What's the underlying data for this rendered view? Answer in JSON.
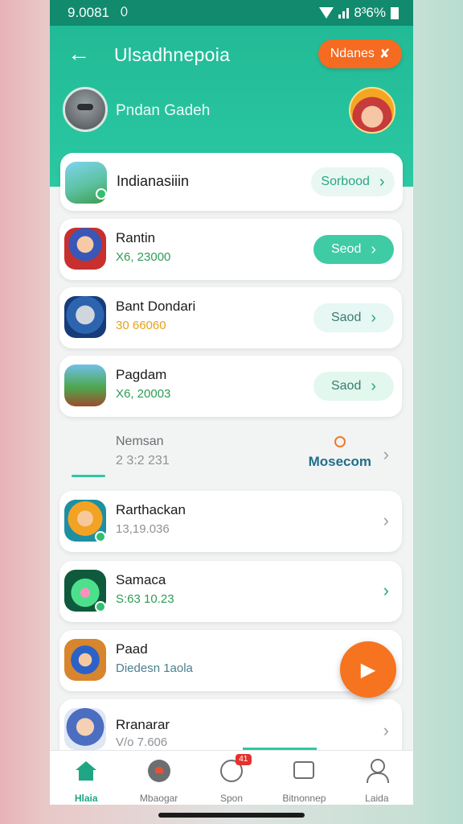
{
  "status": {
    "time": "9.0081",
    "cam_glyph": "⬯",
    "battery_text": "8³6%"
  },
  "header": {
    "back_glyph": "←",
    "title": "Ulsadhnepoia",
    "action_label": "Ndanes",
    "action_glyph": "✘",
    "user_name": "Pndan Gadeh"
  },
  "featured": {
    "name": "Indianasiiin",
    "button_label": "Sorbood"
  },
  "apps": [
    {
      "name": "Rantin",
      "sub": "X6, 23000",
      "button_label": "Seod"
    },
    {
      "name": "Bant Dondari",
      "sub": "30 66060",
      "button_label": "Saod"
    },
    {
      "name": "Pagdam",
      "sub": "X6, 20003",
      "button_label": "Saod"
    }
  ],
  "plain_row": {
    "name": "Nemsan",
    "sub": "2 3:2 231",
    "link_label": "Mosecom"
  },
  "list": [
    {
      "name": "Rarthackan",
      "sub": "13,19.036"
    },
    {
      "name": "Samaca",
      "sub": "S:63 10.23"
    },
    {
      "name": "Paad",
      "sub": "Diedesn  1aola"
    },
    {
      "name": "Rranarar",
      "sub": "V/o 7.606"
    }
  ],
  "fab_glyph": "▶",
  "chevron_glyph": "›",
  "nav": {
    "items": [
      {
        "label": "Hlaia"
      },
      {
        "label": "Mbaogar"
      },
      {
        "label": "Spon",
        "badge": "41"
      },
      {
        "label": "Bitnonnep"
      },
      {
        "label": "Laida"
      }
    ]
  },
  "colors": {
    "accent": "#26c29d",
    "fab": "#f6731f",
    "link": "#1f6f8b"
  }
}
